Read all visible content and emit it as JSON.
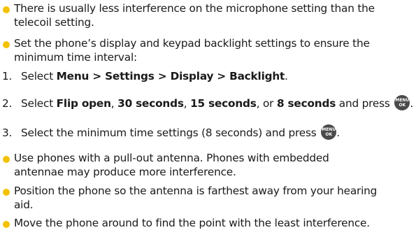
{
  "bullets": [
    {
      "line1": "There is usually less interference on the microphone setting than the",
      "line2": "telecoil setting."
    },
    {
      "line1": "Set the phone’s display and keypad backlight settings to ensure the",
      "line2": "minimum time interval:"
    },
    {
      "line1": "Use phones with a pull-out antenna. Phones with embedded",
      "line2": "antennae may produce more interference."
    },
    {
      "line1": "Position the phone so the antenna is farthest away from your hearing",
      "line2": "aid."
    },
    {
      "line1": "Move the phone around to find the point with the least interference."
    }
  ],
  "steps": [
    {
      "num": "1.",
      "prefix": "Select ",
      "bold1": "Menu > Settings > Display > Backlight",
      "suffix": "."
    },
    {
      "num": "2.",
      "prefix": "Select ",
      "bold1": "Flip open",
      "sep1": ", ",
      "bold2": "30 seconds",
      "sep2": ", ",
      "bold3": "15 seconds",
      "sep3": ", or ",
      "bold4": "8 seconds",
      "suffix": " and press",
      "end": "."
    },
    {
      "num": "3.",
      "text": "Select the minimum time settings (8 seconds) and press",
      "end": "."
    }
  ],
  "menu_ok_key": {
    "icon": "menu-ok-key-icon",
    "top": "MENU",
    "bottom": "OK",
    "color": "#4a4a4a"
  },
  "bullet_color": "#f2c200"
}
